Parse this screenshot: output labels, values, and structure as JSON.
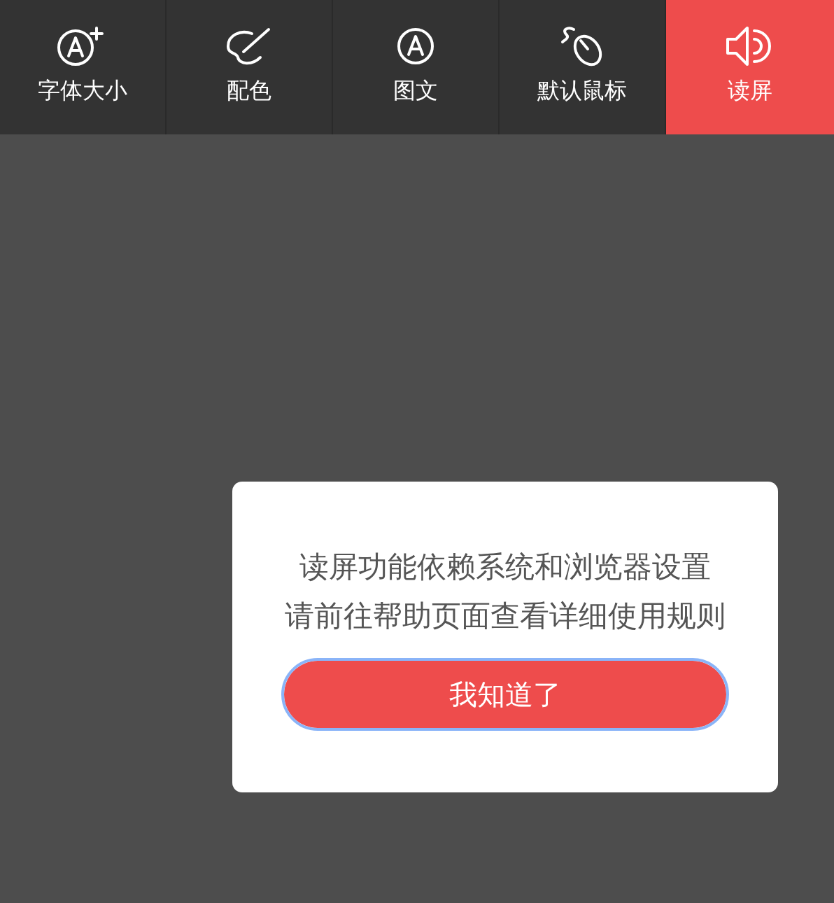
{
  "toolbar": {
    "items": [
      {
        "label": "字体大小",
        "kind": "font-size",
        "selected": false
      },
      {
        "label": "配色",
        "kind": "palette",
        "selected": false
      },
      {
        "label": "图文",
        "kind": "font",
        "selected": false
      },
      {
        "label": "默认鼠标",
        "kind": "mouse",
        "selected": false
      },
      {
        "label": "读屏",
        "kind": "speaker",
        "selected": true
      }
    ]
  },
  "dialog": {
    "lines": [
      "读屏功能依赖系统和浏览器设置",
      "请前往帮助页面查看详细使用规则"
    ],
    "button": {
      "label": "我知道了",
      "focused": true
    }
  }
}
